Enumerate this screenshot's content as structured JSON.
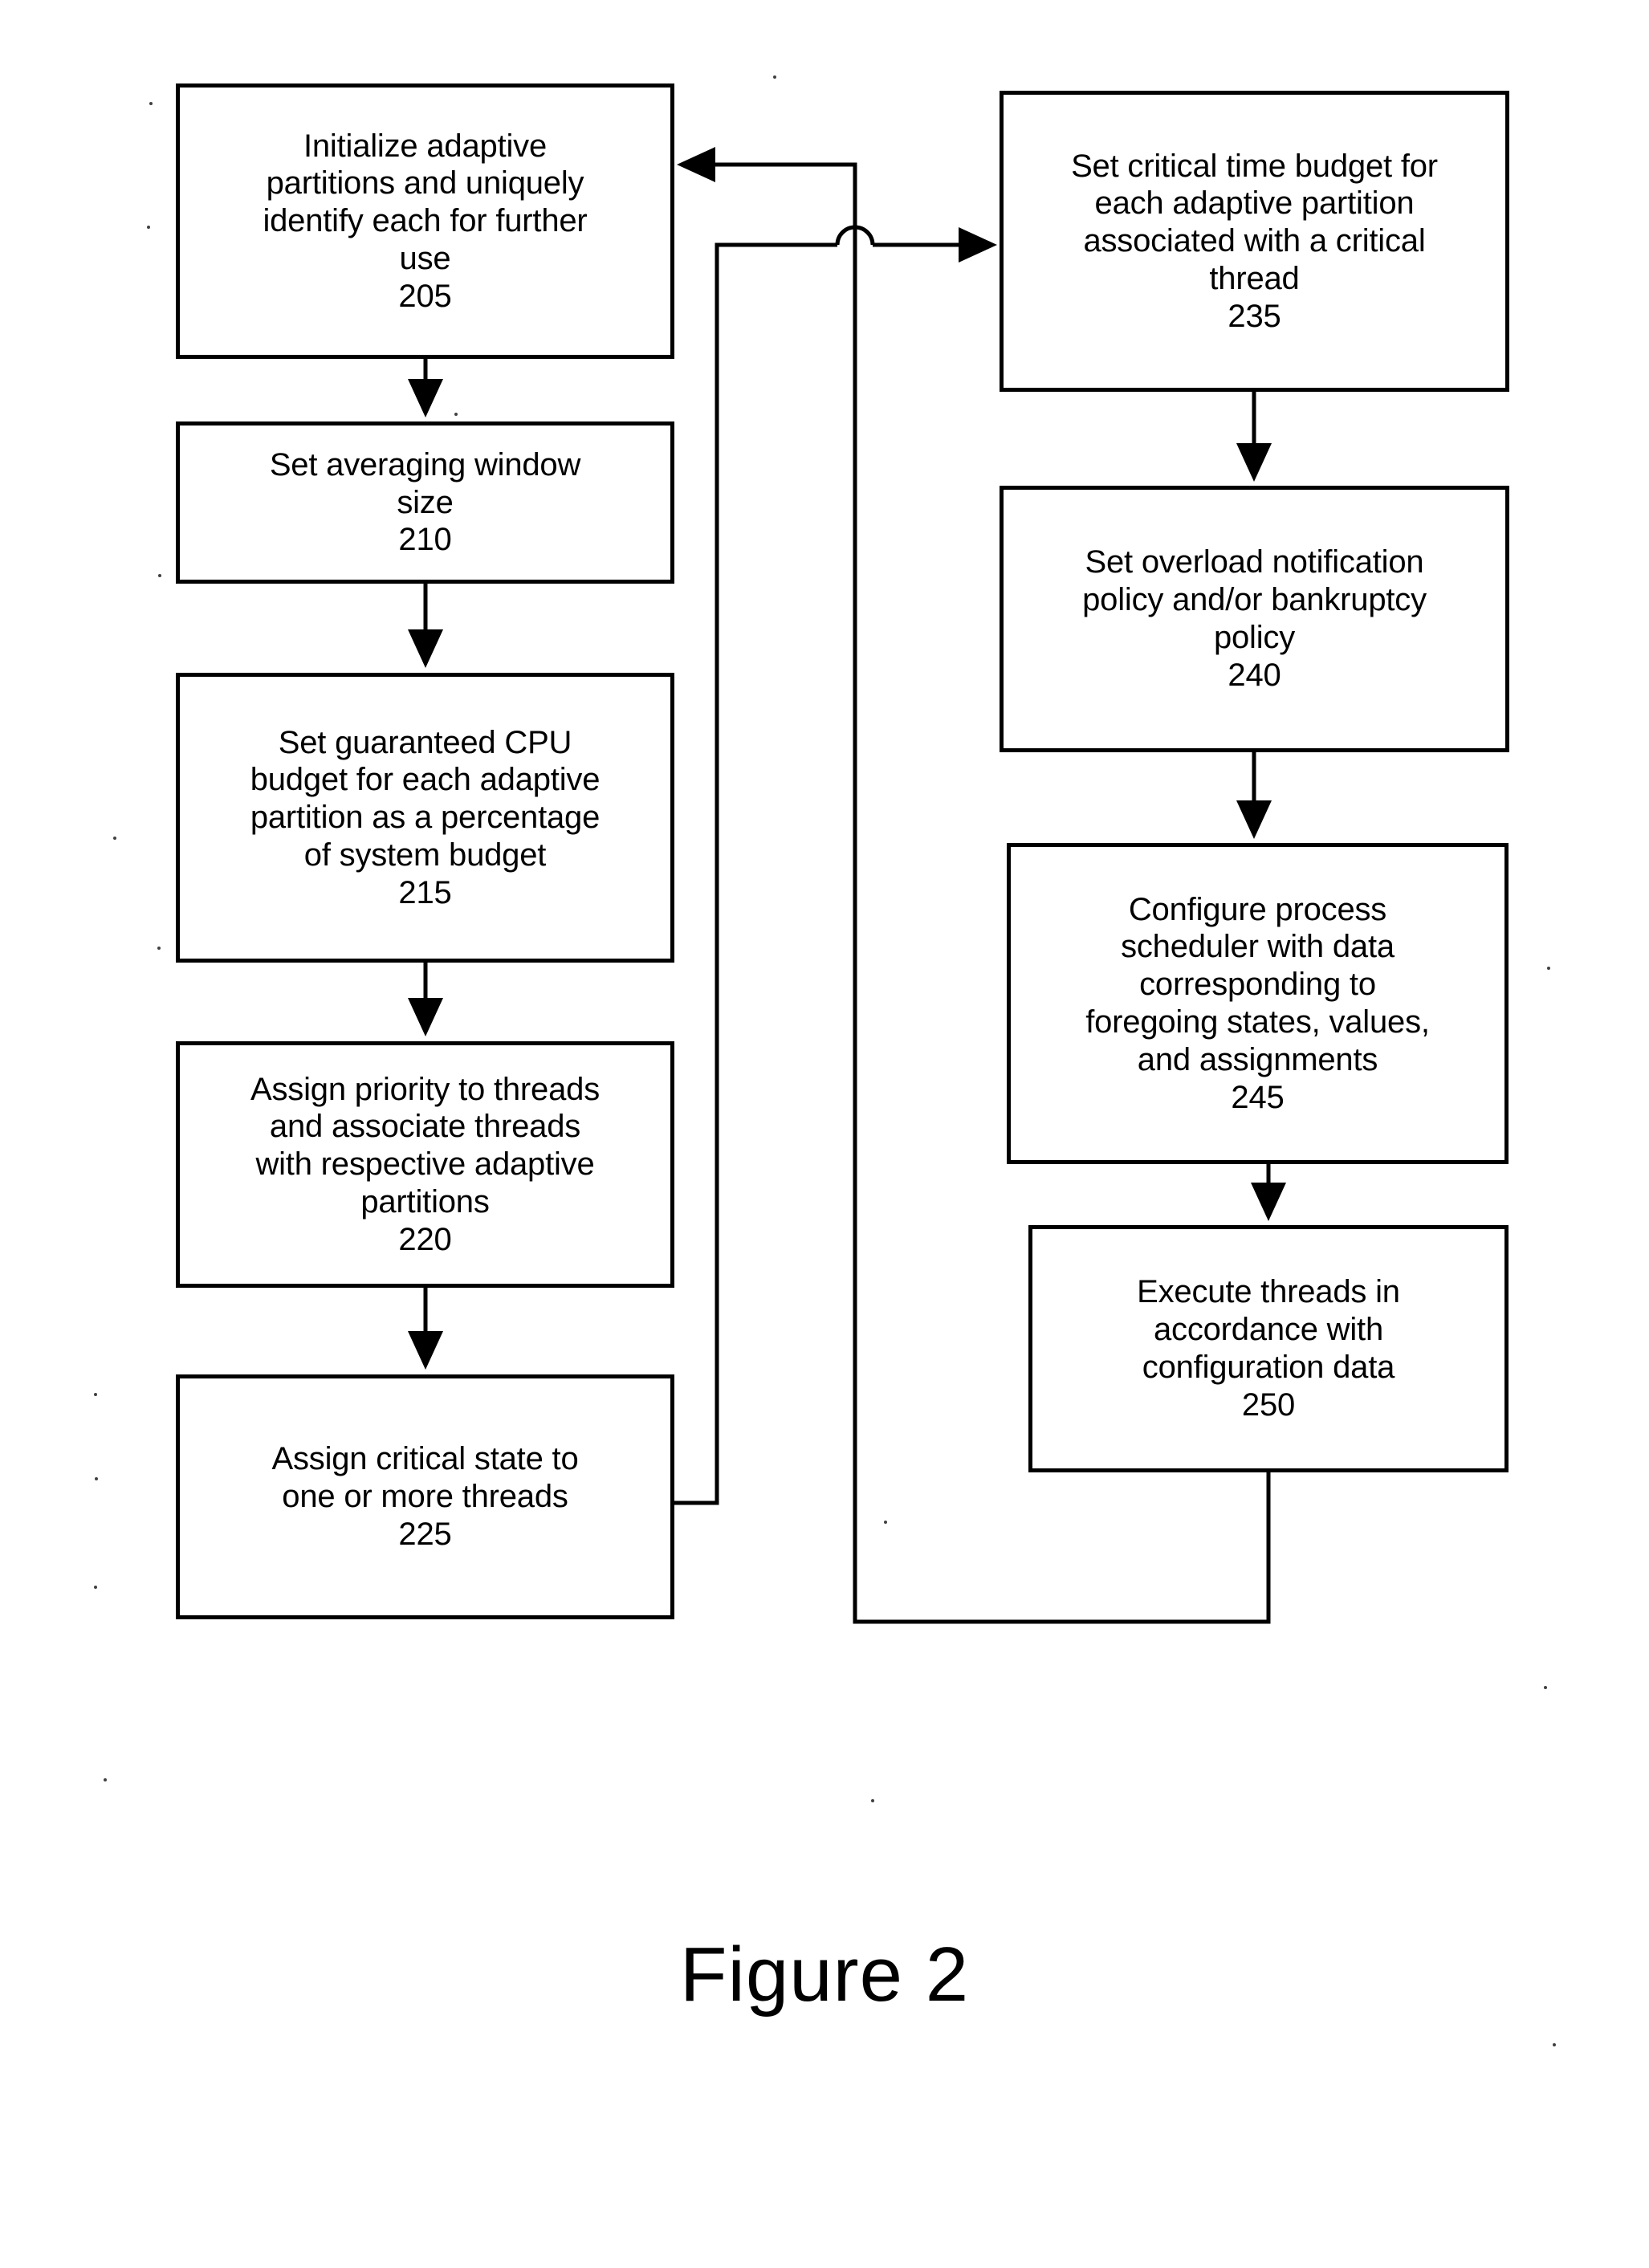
{
  "figure": {
    "caption": "Figure 2"
  },
  "flowchart": {
    "type": "flowchart",
    "orientation": "two-column, left column flows top-to-bottom then crosses to right column",
    "nodes": [
      {
        "id": "205",
        "text": "Initialize adaptive\npartitions and uniquely\nidentify each for further\nuse",
        "ref": "205",
        "column": "left"
      },
      {
        "id": "210",
        "text": "Set averaging window\nsize",
        "ref": "210",
        "column": "left"
      },
      {
        "id": "215",
        "text": "Set guaranteed CPU\nbudget for each adaptive\npartition as a percentage\nof system budget",
        "ref": "215",
        "column": "left"
      },
      {
        "id": "220",
        "text": "Assign priority to threads\nand associate threads\nwith respective adaptive\npartitions",
        "ref": "220",
        "column": "left"
      },
      {
        "id": "225",
        "text": "Assign critical state to\none or more threads",
        "ref": "225",
        "column": "left"
      },
      {
        "id": "235",
        "text": "Set critical time budget for\neach adaptive partition\nassociated with a critical\nthread",
        "ref": "235",
        "column": "right"
      },
      {
        "id": "240",
        "text": "Set overload notification\npolicy and/or bankruptcy\npolicy",
        "ref": "240",
        "column": "right"
      },
      {
        "id": "245",
        "text": "Configure process\nscheduler with data\ncorresponding to\nforegoing states, values,\nand assignments",
        "ref": "245",
        "column": "right"
      },
      {
        "id": "250",
        "text": "Execute threads in\naccordance with\nconfiguration data",
        "ref": "250",
        "column": "right"
      }
    ],
    "edges": [
      {
        "from": "205",
        "to": "210",
        "style": "straight-down-arrow"
      },
      {
        "from": "210",
        "to": "215",
        "style": "straight-down-arrow"
      },
      {
        "from": "215",
        "to": "220",
        "style": "straight-down-arrow"
      },
      {
        "from": "220",
        "to": "225",
        "style": "straight-down-arrow"
      },
      {
        "from": "225",
        "to": "235",
        "style": "right-then-up-then-right-arrow-with-line-hop"
      },
      {
        "from": "235",
        "to": "240",
        "style": "straight-down-arrow"
      },
      {
        "from": "240",
        "to": "245",
        "style": "straight-down-arrow"
      },
      {
        "from": "245",
        "to": "250",
        "style": "straight-down-arrow"
      },
      {
        "from": "250",
        "to": "205",
        "style": "down-then-left-then-up-then-left-arrow"
      }
    ],
    "line_color": "#000000",
    "background_color": "#ffffff"
  }
}
